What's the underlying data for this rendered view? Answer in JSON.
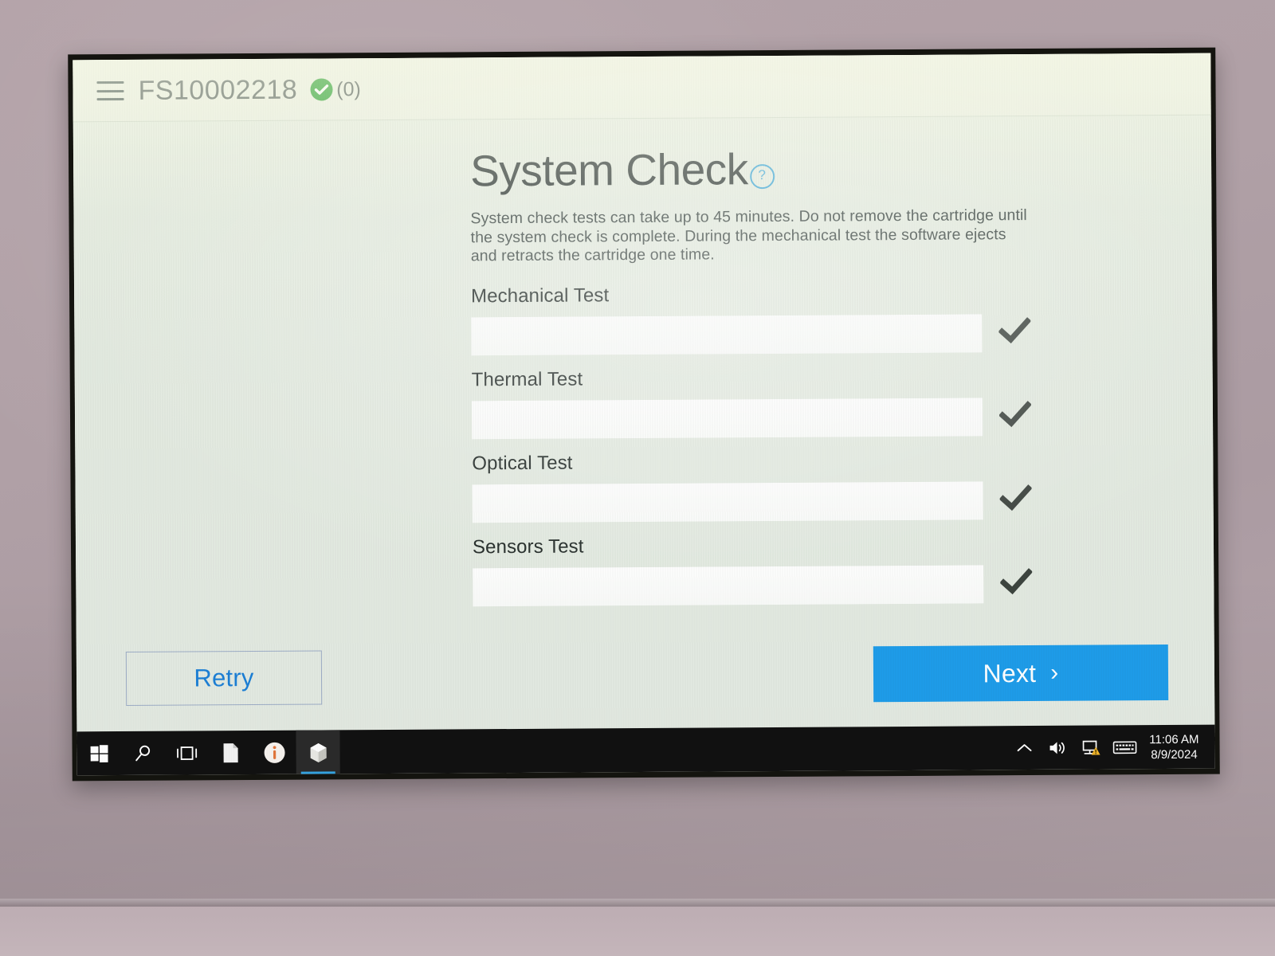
{
  "appbar": {
    "menu_icon": "hamburger-menu-icon",
    "device_id": "FS10002218",
    "status_icon": "green-check-circle-icon",
    "alarm_count": "(0)"
  },
  "page": {
    "title": "System Check",
    "help_icon": "?",
    "description": "System check tests can take up to 45 minutes. Do not remove the cartridge until the system check is complete. During the mechanical test the software ejects and retracts the cartridge one time."
  },
  "tests": [
    {
      "label": "Mechanical Test",
      "progress": 100,
      "result_icon": "checkmark-icon"
    },
    {
      "label": "Thermal Test",
      "progress": 100,
      "result_icon": "checkmark-icon"
    },
    {
      "label": "Optical Test",
      "progress": 100,
      "result_icon": "checkmark-icon"
    },
    {
      "label": "Sensors Test",
      "progress": 100,
      "result_icon": "checkmark-icon"
    }
  ],
  "footer": {
    "retry_label": "Retry",
    "next_label": "Next",
    "next_chevron": "›"
  },
  "taskbar": {
    "items": [
      {
        "name": "start-button",
        "icon": "windows-logo-icon"
      },
      {
        "name": "search-button",
        "icon": "search-icon"
      },
      {
        "name": "task-view-button",
        "icon": "task-view-icon"
      },
      {
        "name": "file-explorer-button",
        "icon": "document-icon"
      },
      {
        "name": "info-app-button",
        "icon": "orange-info-circle-icon"
      },
      {
        "name": "instrument-app-button",
        "icon": "cartridge-app-icon"
      }
    ],
    "tray": [
      {
        "name": "show-hidden-icons-button",
        "icon": "chevron-up-icon"
      },
      {
        "name": "volume-button",
        "icon": "speaker-icon"
      },
      {
        "name": "network-button",
        "icon": "network-warning-icon"
      },
      {
        "name": "touch-keyboard-button",
        "icon": "keyboard-icon"
      }
    ],
    "clock": {
      "time": "11:06 AM",
      "date": "8/9/2024"
    }
  },
  "colors": {
    "accent_blue": "#1E9CE9",
    "link_blue": "#1C7FD6",
    "status_green": "#1F9E24",
    "help_blue": "#3FA8D8",
    "screen_bg": "#E3EAE0"
  }
}
